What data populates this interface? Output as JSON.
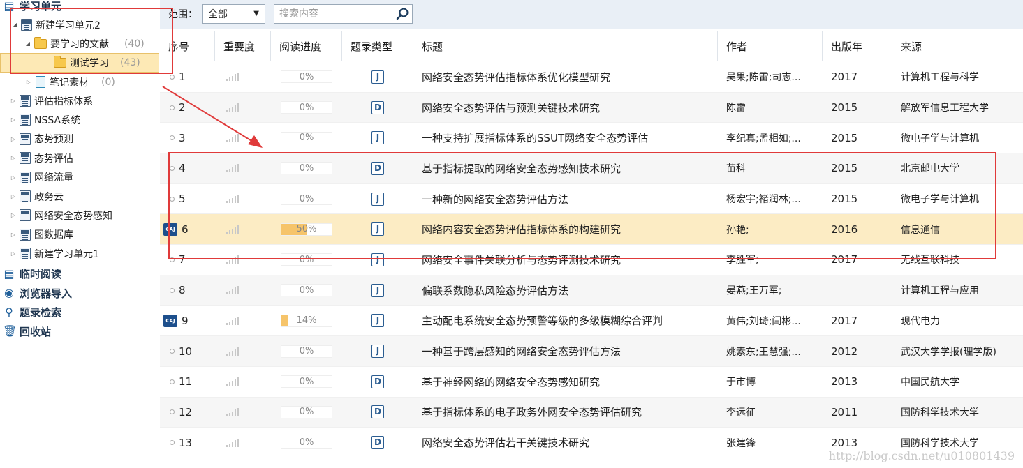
{
  "sidebar": {
    "root": "学习单元",
    "unit2": "新建学习单元2",
    "folder_main": {
      "label": "要学习的文献",
      "count": "(40)"
    },
    "folder_sub": {
      "label": "测试学习",
      "count": "(43)"
    },
    "notes": {
      "label": "笔记素材",
      "count": "(0)"
    },
    "units": [
      "评估指标体系",
      "NSSA系统",
      "态势预测",
      "态势评估",
      "网络流量",
      "政务云",
      "网络安全态势感知",
      "图数据库",
      "新建学习单元1"
    ],
    "bottom": [
      "临时阅读",
      "浏览器导入",
      "题录检索",
      "回收站"
    ]
  },
  "toolbar": {
    "scope_label": "范围：",
    "scope_value": "全部",
    "search_placeholder": "搜索内容"
  },
  "table": {
    "headers": [
      "序号",
      "重要度",
      "阅读进度",
      "题录类型",
      "标题",
      "作者",
      "出版年",
      "来源"
    ],
    "rows": [
      {
        "seq": "1",
        "caj": false,
        "progress": "0%",
        "type": "J",
        "title": "网络安全态势评估指标体系优化模型研究",
        "author": "吴果;陈雷;司志...",
        "year": "2017",
        "source": "计算机工程与科学"
      },
      {
        "seq": "2",
        "caj": false,
        "progress": "0%",
        "type": "D",
        "title": "网络安全态势评估与预测关键技术研究",
        "author": "陈雷",
        "year": "2015",
        "source": "解放军信息工程大学"
      },
      {
        "seq": "3",
        "caj": false,
        "progress": "0%",
        "type": "J",
        "title": "一种支持扩展指标体系的SSUT网络安全态势评估",
        "author": "李纪真;孟相如;...",
        "year": "2015",
        "source": "微电子学与计算机"
      },
      {
        "seq": "4",
        "caj": false,
        "progress": "0%",
        "type": "D",
        "title": "基于指标提取的网络安全态势感知技术研究",
        "author": "苗科",
        "year": "2015",
        "source": "北京邮电大学"
      },
      {
        "seq": "5",
        "caj": false,
        "progress": "0%",
        "type": "J",
        "title": "一种新的网络安全态势评估方法",
        "author": "杨宏宇;褚润林;...",
        "year": "2015",
        "source": "微电子学与计算机"
      },
      {
        "seq": "6",
        "caj": true,
        "progress": "50%",
        "type": "J",
        "title": "网络内容安全态势评估指标体系的构建研究",
        "author": "孙艳;",
        "year": "2016",
        "source": "信息通信"
      },
      {
        "seq": "7",
        "caj": false,
        "progress": "0%",
        "type": "J",
        "title": "网络安全事件关联分析与态势评测技术研究",
        "author": "李胜军;",
        "year": "2017",
        "source": "无线互联科技"
      },
      {
        "seq": "8",
        "caj": false,
        "progress": "0%",
        "type": "J",
        "title": "偏联系数隐私风险态势评估方法",
        "author": "晏燕;王万军;",
        "year": "",
        "source": "计算机工程与应用"
      },
      {
        "seq": "9",
        "caj": true,
        "progress": "14%",
        "type": "J",
        "title": "主动配电系统安全态势预警等级的多级模糊综合评判",
        "author": "黄伟;刘琦;闫彬...",
        "year": "2017",
        "source": "现代电力"
      },
      {
        "seq": "10",
        "caj": false,
        "progress": "0%",
        "type": "J",
        "title": "一种基于跨层感知的网络安全态势评估方法",
        "author": "姚素东;王慧强;...",
        "year": "2012",
        "source": "武汉大学学报(理学版)"
      },
      {
        "seq": "11",
        "caj": false,
        "progress": "0%",
        "type": "D",
        "title": "基于神经网络的网络安全态势感知研究",
        "author": "于市博",
        "year": "2013",
        "source": "中国民航大学"
      },
      {
        "seq": "12",
        "caj": false,
        "progress": "0%",
        "type": "D",
        "title": "基于指标体系的电子政务外网安全态势评估研究",
        "author": "李远征",
        "year": "2011",
        "source": "国防科学技术大学"
      },
      {
        "seq": "13",
        "caj": false,
        "progress": "0%",
        "type": "D",
        "title": "网络安全态势评估若干关键技术研究",
        "author": "张建锋",
        "year": "2013",
        "source": "国防科学技术大学"
      }
    ]
  },
  "caj_badge": "CAJ",
  "watermark": "http://blog.csdn.net/u010801439",
  "colors": {
    "annotation": "#e03a3a",
    "selected": "#fde9b5",
    "highlight_row": "#fcecc4",
    "progress_fill": "#f6c46a"
  }
}
